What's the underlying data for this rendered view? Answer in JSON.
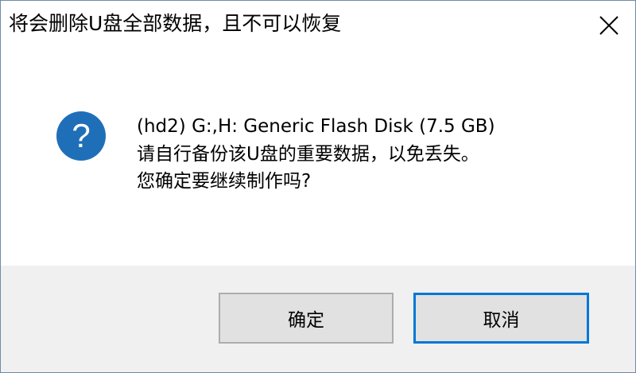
{
  "window": {
    "title": "将会删除U盘全部数据，且不可以恢复"
  },
  "icons": {
    "close": "close-icon",
    "question": "question-icon"
  },
  "message": {
    "lines": [
      "(hd2) G:,H: Generic Flash Disk (7.5 GB)",
      "请自行备份该U盘的重要数据，以免丢失。",
      "您确定要继续制作吗?"
    ]
  },
  "buttons": {
    "ok_label": "确定",
    "cancel_label": "取消"
  },
  "colors": {
    "icon_blue": "#1f6fb8",
    "focus_border": "#0078d7",
    "footer_bg": "#f0f0f0",
    "button_bg": "#e1e1e1"
  }
}
